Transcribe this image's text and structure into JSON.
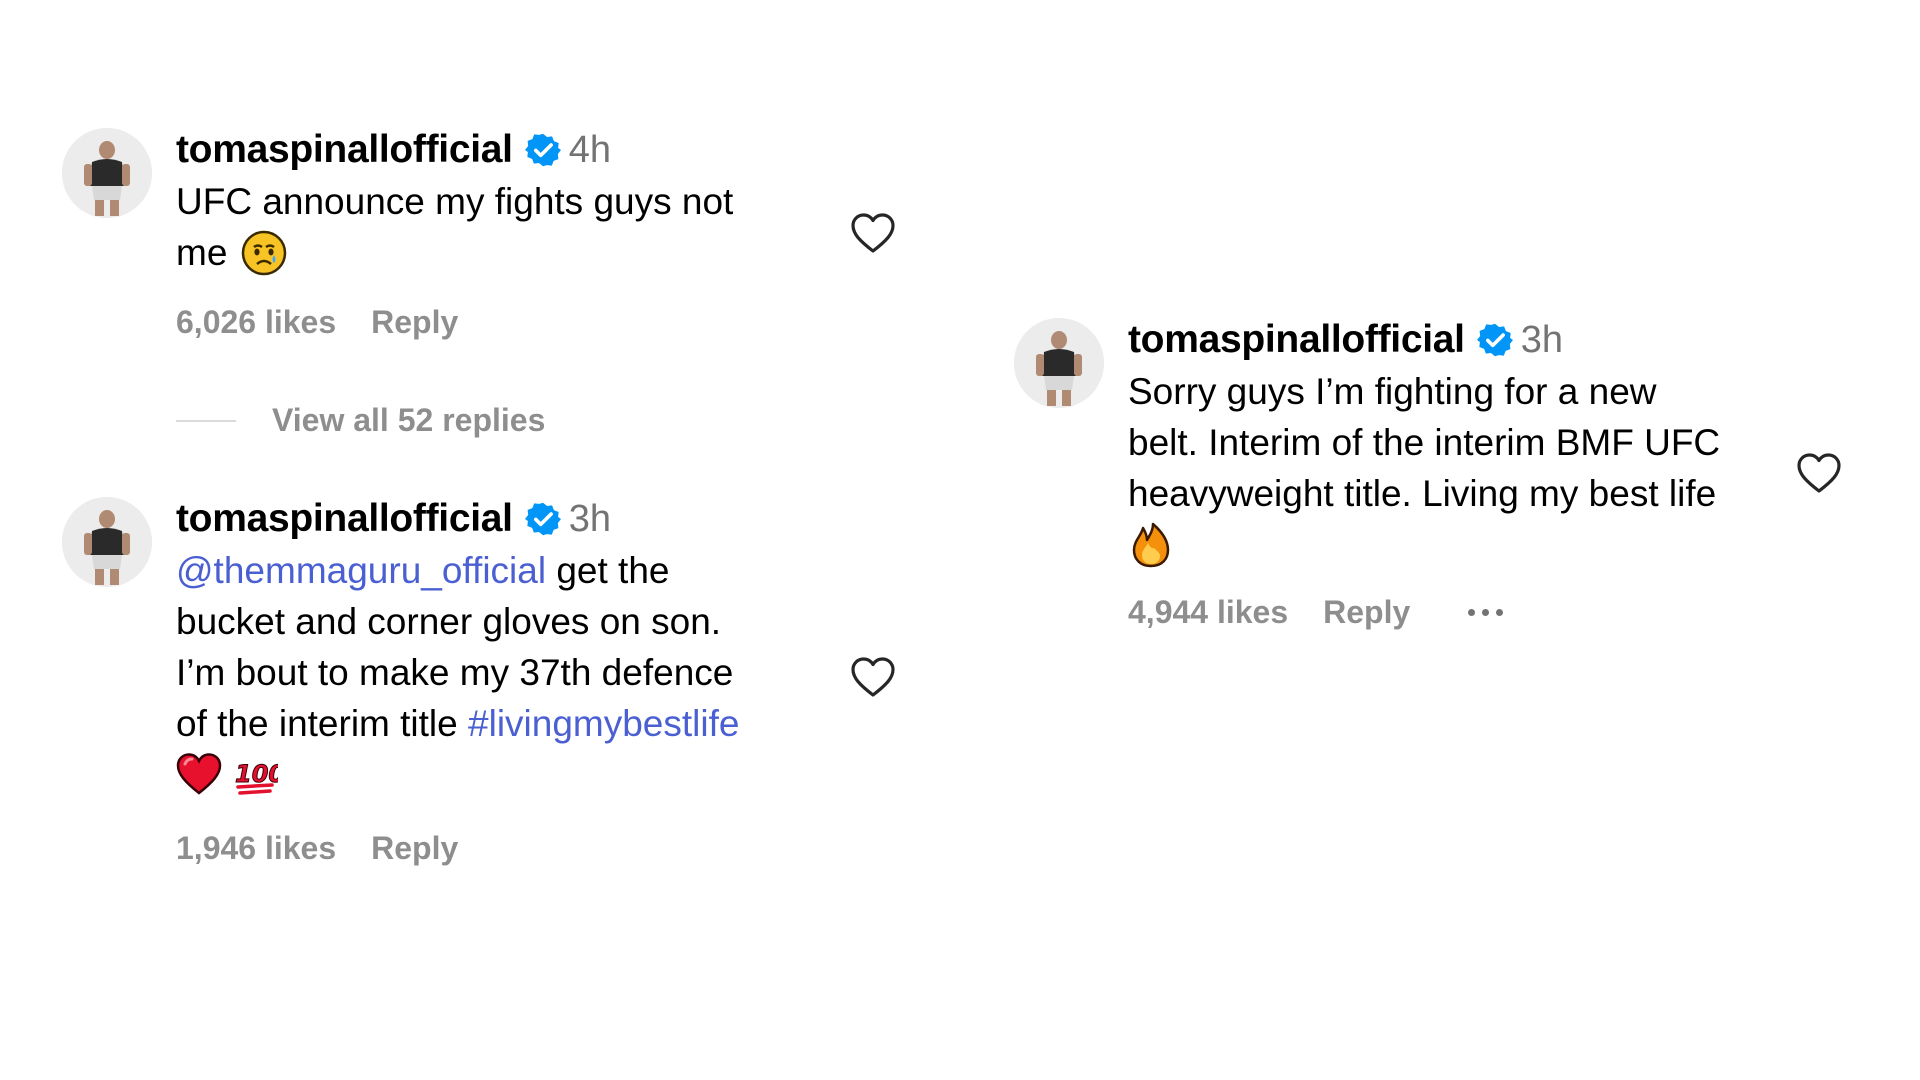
{
  "comments": [
    {
      "username": "tomaspinallofficial",
      "time": "4h",
      "text_line1": "UFC announce my fights guys not",
      "text_line2": "me",
      "likes": "6,026 likes",
      "reply": "Reply",
      "emoji": "crying-face-icon"
    },
    {
      "username": "tomaspinallofficial",
      "time": "3h",
      "mention": "@themmaguru_official",
      "text_after_mention": " get the",
      "text_line2": "bucket and corner gloves on son.",
      "text_line3": "I’m bout to make my 37th defence",
      "text_line4": "of the interim title ",
      "hashtag": "#livingmybestlife",
      "likes": "1,946 likes",
      "reply": "Reply",
      "emojis": [
        "red-heart-icon",
        "hundred-points-icon"
      ]
    },
    {
      "username": "tomaspinallofficial",
      "time": "3h",
      "text_line1": "Sorry guys I’m fighting for a new",
      "text_line2": "belt. Interim of the interim BMF UFC",
      "text_line3": "heavyweight title. Living my best life",
      "likes": "4,944 likes",
      "reply": "Reply",
      "emoji": "fire-icon"
    }
  ],
  "view_replies": "View all 52 replies",
  "colors": {
    "link": "#4a5fd1",
    "muted": "#8e8e8e",
    "verified": "#0095f6"
  }
}
